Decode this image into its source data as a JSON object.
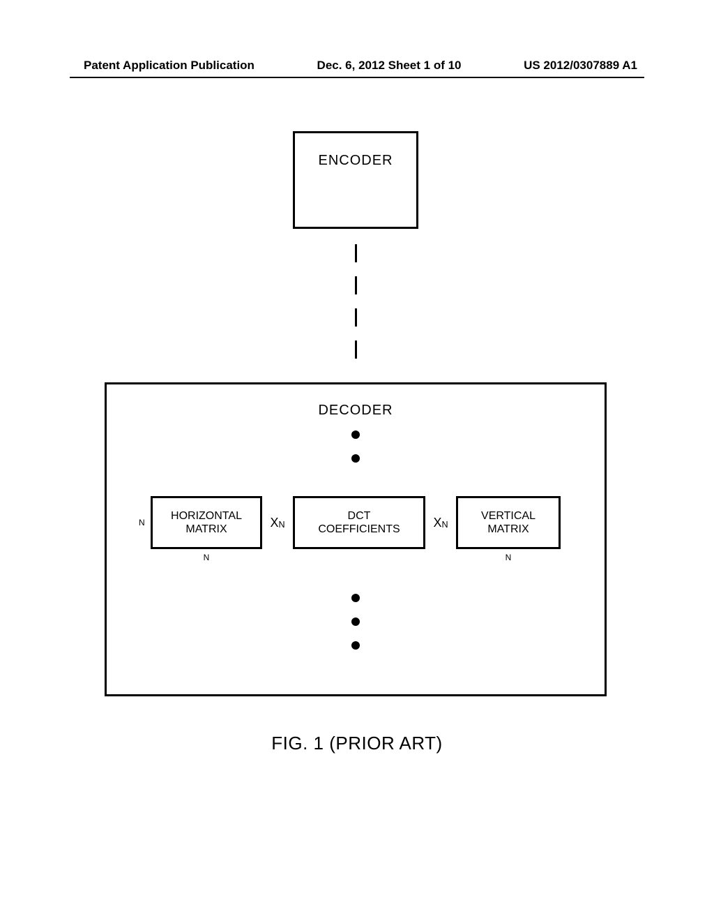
{
  "header": {
    "left": "Patent Application Publication",
    "center": "Dec. 6, 2012  Sheet 1 of 10",
    "right": "US 2012/0307889 A1"
  },
  "encoder": {
    "label": "ENCODER"
  },
  "decoder": {
    "title": "DECODER",
    "horizontal": {
      "line1": "HORIZONTAL",
      "line2": "MATRIX",
      "dim": "N"
    },
    "coeffs": {
      "line1": "DCT",
      "line2": "COEFFICIENTS"
    },
    "vertical": {
      "line1": "VERTICAL",
      "line2": "MATRIX",
      "dim": "N"
    },
    "xn1": "X",
    "xn1_sub": "N",
    "xn2": "X",
    "xn2_sub": "N"
  },
  "caption": "FIG. 1 (PRIOR ART)"
}
